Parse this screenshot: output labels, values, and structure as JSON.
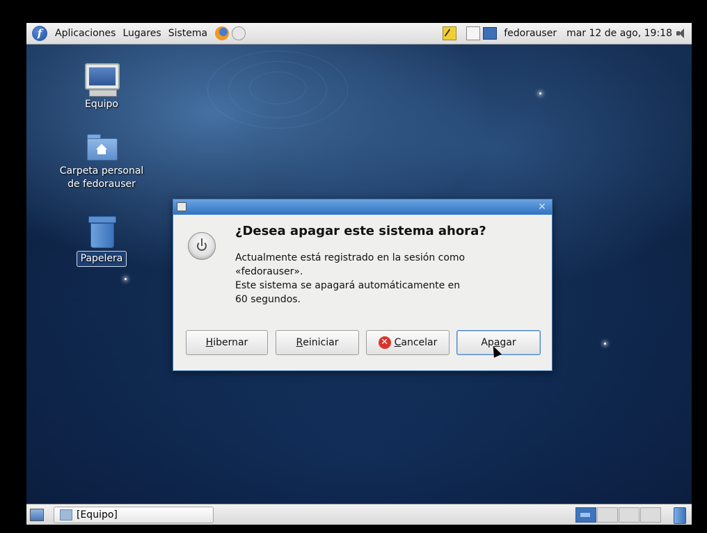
{
  "top_panel": {
    "menus": [
      "Aplicaciones",
      "Lugares",
      "Sistema"
    ],
    "username": "fedorauser",
    "clock": "mar 12 de ago, 19:18",
    "icons": [
      "fedora-logo-icon",
      "firefox-icon",
      "mail-icon",
      "notes-icon",
      "clipboard-icon",
      "network-icon",
      "volume-icon"
    ]
  },
  "desktop": {
    "icons": [
      {
        "label": "Equipo",
        "icon": "computer-icon"
      },
      {
        "label": "Carpeta personal de fedorauser",
        "label_lines": [
          "Carpeta personal",
          "de fedorauser"
        ],
        "icon": "home-folder-icon"
      },
      {
        "label": "Papelera",
        "icon": "trash-icon"
      }
    ]
  },
  "dialog": {
    "title": "¿Desea apagar este sistema ahora?",
    "message_lines": [
      "Actualmente está registrado en la sesión como",
      "«fedorauser».",
      "Este sistema se apagará automáticamente en",
      "60 segundos."
    ],
    "buttons": {
      "hibernate": {
        "mnemonic": "H",
        "rest": "ibernar"
      },
      "restart": {
        "mnemonic": "R",
        "rest": "einiciar"
      },
      "cancel": {
        "mnemonic": "C",
        "rest": "ancelar"
      },
      "shutdown": {
        "pre": "Ap",
        "mnemonic": "a",
        "rest": "gar"
      }
    }
  },
  "bottom_panel": {
    "task": "[Equipo]",
    "workspaces": 4,
    "active_workspace": 1
  }
}
